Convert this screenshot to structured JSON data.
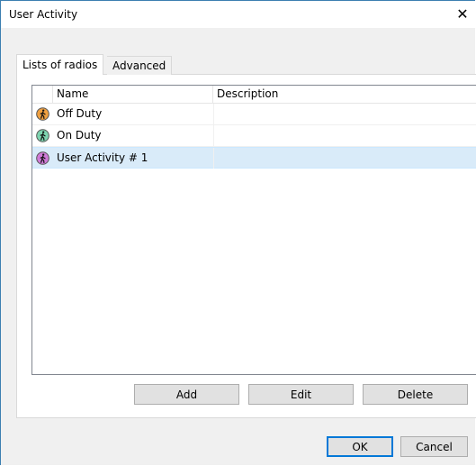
{
  "window": {
    "title": "User Activity",
    "close_glyph": "✕"
  },
  "tabs": [
    {
      "label": "Lists of radios",
      "active": true
    },
    {
      "label": "Advanced",
      "active": false
    }
  ],
  "list": {
    "columns": [
      "Name",
      "Description"
    ],
    "rows": [
      {
        "name": "Off Duty",
        "description": "",
        "icon": "user-activity-icon",
        "icon_color": "#f0a040",
        "selected": false
      },
      {
        "name": "On Duty",
        "description": "",
        "icon": "user-activity-icon",
        "icon_color": "#7ed4b0",
        "selected": false
      },
      {
        "name": "User Activity # 1",
        "description": "",
        "icon": "user-activity-icon",
        "icon_color": "#d07ad8",
        "selected": true
      }
    ]
  },
  "actions": {
    "add_label": "Add",
    "edit_label": "Edit",
    "delete_label": "Delete"
  },
  "footer": {
    "ok_label": "OK",
    "cancel_label": "Cancel"
  },
  "colors": {
    "selection": "#d9ebf9",
    "accent": "#0078d7",
    "window_border": "#3c7fb1"
  }
}
